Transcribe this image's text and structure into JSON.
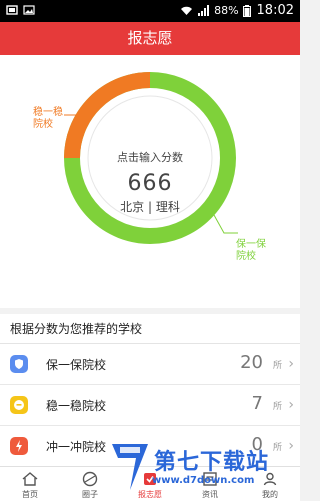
{
  "status_bar": {
    "battery": "88%",
    "time": "18:02"
  },
  "app_bar": {
    "title": "报志愿"
  },
  "hero": {
    "prompt": "点击输入分数",
    "score": "666",
    "region": "北京 | 理科",
    "label_orange": "稳一稳\n院校",
    "label_green": "保一保\n院校",
    "colors": {
      "orange": "#f07a23",
      "green": "#7fd13a"
    }
  },
  "section": {
    "title": "根据分数为您推荐的学校"
  },
  "schools": [
    {
      "name": "保一保院校",
      "count": "20",
      "unit": "所",
      "icon": "shield-icon",
      "color": "#5b8def"
    },
    {
      "name": "稳一稳院校",
      "count": "7",
      "unit": "所",
      "icon": "smile-icon",
      "color": "#f5c518"
    },
    {
      "name": "冲一冲院校",
      "count": "0",
      "unit": "所",
      "icon": "lightning-icon",
      "color": "#ef5a3c"
    }
  ],
  "tabs": [
    {
      "label": "首页",
      "icon": "home-icon"
    },
    {
      "label": "圈子",
      "icon": "circle-icon"
    },
    {
      "label": "报志愿",
      "icon": "volunteer-icon"
    },
    {
      "label": "资讯",
      "icon": "news-icon"
    },
    {
      "label": "我的",
      "icon": "profile-icon"
    }
  ],
  "watermark": {
    "text": "第七下载站",
    "url": "www.d7down.com"
  }
}
